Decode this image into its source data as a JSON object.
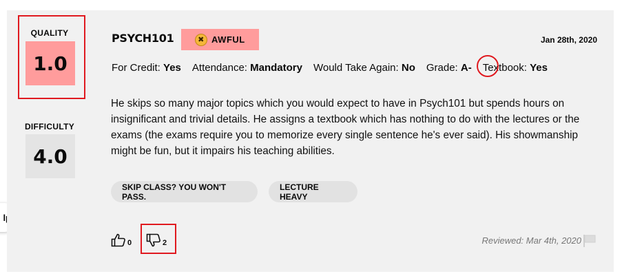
{
  "rating": {
    "quality_label": "QUALITY",
    "quality_value": "1.0",
    "difficulty_label": "DIFFICULTY",
    "difficulty_value": "4.0",
    "course": "PSYCH101",
    "emotion": "AWFUL",
    "emotion_icon": "angry-face-icon",
    "date": "Jan 28th, 2020",
    "meta": {
      "for_credit_label": "For Credit:",
      "for_credit": "Yes",
      "attendance_label": "Attendance:",
      "attendance": "Mandatory",
      "would_take_again_label": "Would Take Again:",
      "would_take_again": "No",
      "grade_label": "Grade:",
      "grade": "A-",
      "textbook_label": "Textbook:",
      "textbook": "Yes"
    },
    "comment": "He skips so many major topics which you would expect to have in Psych101 but spends hours on insignificant and trivial details. He assigns a textbook which has nothing to do with the lectures or the exams (the exams require you to memorize every single sentence he's ever said). His showmanship might be fun, but it impairs his teaching abilities.",
    "tags": [
      "SKIP CLASS? YOU WON'T PASS.",
      "LECTURE HEAVY"
    ],
    "thumbs_up_count": "0",
    "thumbs_down_count": "2",
    "reviewed": "Reviewed: Mar 4th, 2020"
  },
  "help_tab": "lp",
  "colors": {
    "card_bg": "#f1f1f1",
    "awful": "#ff9c9c",
    "difficulty_bg": "#e4e4e4",
    "tag_bg": "#e2e2e2",
    "annotation": "#e0191f"
  }
}
